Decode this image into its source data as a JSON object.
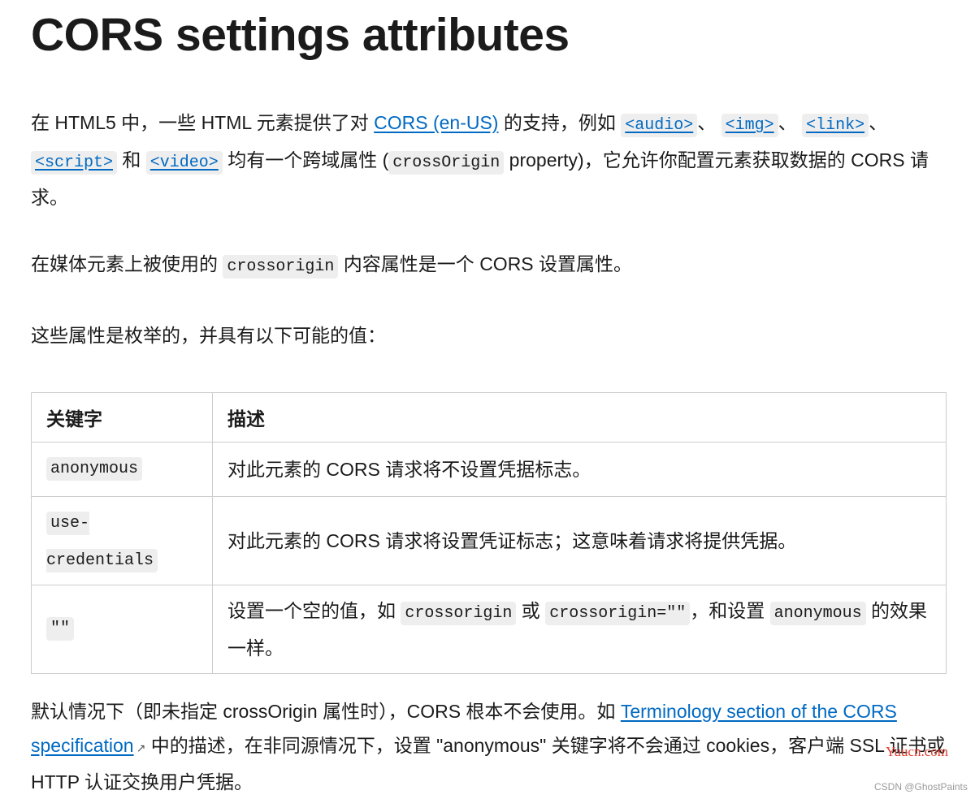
{
  "title": "CORS settings attributes",
  "intro": {
    "t1": "在 HTML5 中，一些 HTML 元素提供了对 ",
    "link_cors": "CORS (en-US)",
    "t2": " 的支持，例如 ",
    "el_audio": "<audio>",
    "sep1": "、",
    "el_img": "<img>",
    "sep2": "、",
    "el_link": "<link>",
    "sep3": "、",
    "el_script": "<script>",
    "t3": " 和 ",
    "el_video": "<video>",
    "t4": " 均有一个跨域属性 (",
    "code_crossOrigin": "crossOrigin",
    "t5": " property)，它允许你配置元素获取数据的 CORS 请求。"
  },
  "para2": {
    "t1": "在媒体元素上被使用的 ",
    "code": "crossorigin",
    "t2": " 内容属性是一个 CORS 设置属性。"
  },
  "para3": "这些属性是枚举的，并具有以下可能的值：",
  "table": {
    "headers": [
      "关键字",
      "描述"
    ],
    "rows": [
      {
        "keyword": "anonymous",
        "description": "对此元素的 CORS 请求将不设置凭据标志。"
      },
      {
        "keyword": "use-credentials",
        "description": "对此元素的 CORS 请求将设置凭证标志；这意味着请求将提供凭据。"
      },
      {
        "keyword": "\"\"",
        "d1": "设置一个空的值，如 ",
        "c1": "crossorigin",
        "d2": " 或 ",
        "c2": "crossorigin=\"\"",
        "d3": "，和设置 ",
        "c3": "anonymous",
        "d4": " 的效果一样。"
      }
    ]
  },
  "para4": {
    "t1": "默认情况下（即未指定 crossOrigin 属性时），CORS 根本不会使用。如 ",
    "link": "Terminology section of the CORS specification",
    "ext_icon": "external-link-icon",
    "t2": " 中的描述，在非同源情况下，设置 \"anonymous\" 关键字将不会通过 cookies，客户端 SSL 证书或 HTTP 认证交换用户凭据。"
  },
  "watermark": {
    "site": "Yuucn.com",
    "credit": "CSDN @GhostPaints"
  }
}
